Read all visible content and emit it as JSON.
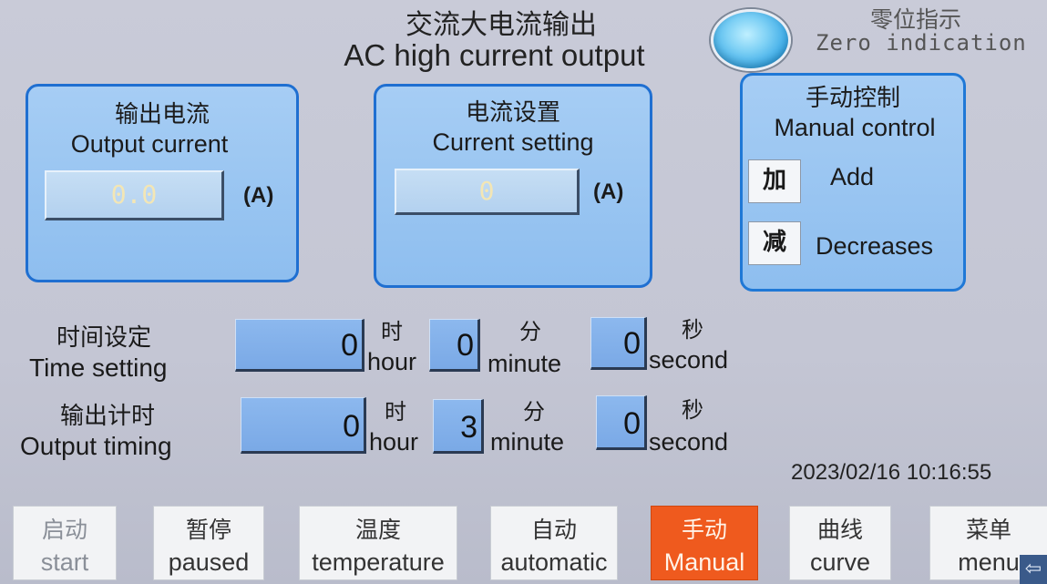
{
  "header": {
    "title_cn": "交流大电流输出",
    "title_en": "AC high current output",
    "zero_indication_cn": "零位指示",
    "zero_indication_en": "Zero indication"
  },
  "output_current": {
    "label_cn": "输出电流",
    "label_en": "Output current",
    "value": "0.0",
    "unit": "(A)"
  },
  "current_setting": {
    "label_cn": "电流设置",
    "label_en": "Current setting",
    "value": "0",
    "unit": "(A)"
  },
  "manual_control": {
    "label_cn": "手动控制",
    "label_en": "Manual control",
    "add_button": "加",
    "add_label": "Add",
    "decrease_button": "减",
    "decrease_label": "Decreases"
  },
  "time_setting": {
    "label_cn": "时间设定",
    "label_en": "Time setting",
    "hour": "0",
    "minute": "0",
    "second": "0"
  },
  "output_timing": {
    "label_cn": "输出计时",
    "label_en": "Output timing",
    "hour": "0",
    "minute": "3",
    "second": "0"
  },
  "units": {
    "hour_cn": "时",
    "hour_en": "hour",
    "minute_cn": "分",
    "minute_en": "minute",
    "second_cn": "秒",
    "second_en": "second"
  },
  "datetime": "2023/02/16 10:16:55",
  "nav": [
    {
      "cn": "启动",
      "en": "start"
    },
    {
      "cn": "暂停",
      "en": "paused"
    },
    {
      "cn": "温度",
      "en": "temperature"
    },
    {
      "cn": "自动",
      "en": "automatic"
    },
    {
      "cn": "手动",
      "en": "Manual"
    },
    {
      "cn": "曲线",
      "en": "curve"
    },
    {
      "cn": "菜单",
      "en": "menu"
    }
  ],
  "colors": {
    "panel_border": "#1f6fd1",
    "panel_fill": "#8ebeef",
    "active_tab": "#ef5a1e",
    "indicator": "#3aa9e6"
  },
  "icons": {
    "zero_indicator": "circle-led",
    "corner": "back-arrow-icon"
  }
}
